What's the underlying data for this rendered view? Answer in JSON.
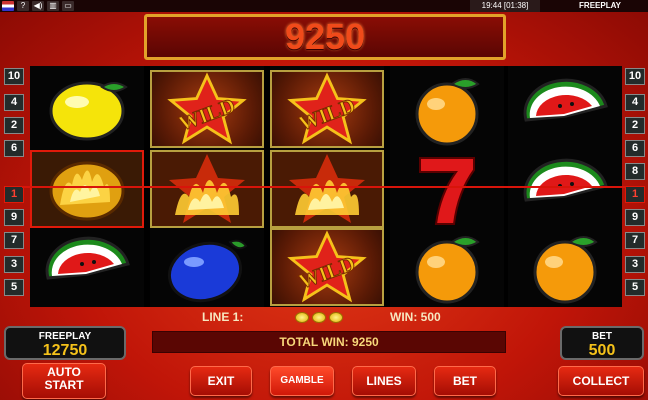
{
  "topbar": {
    "icons": [
      "flag-icon",
      "help-icon",
      "sound-icon",
      "settings-icon",
      "fullscreen-icon"
    ],
    "clock": "19:44 [01:38]",
    "mode": "FREEPLAY"
  },
  "win_display": "9250",
  "reels": [
    [
      "lemon",
      "lemon-burning",
      "watermelon"
    ],
    [
      "wild",
      "wild-burning",
      "plum"
    ],
    [
      "wild",
      "wild-burning",
      "wild"
    ],
    [
      "orange",
      "seven",
      "orange"
    ],
    [
      "watermelon",
      "watermelon",
      "orange"
    ]
  ],
  "lines_left": [
    "10",
    "4",
    "2",
    "6",
    "1",
    "9",
    "7",
    "3",
    "5"
  ],
  "lines_right": [
    "10",
    "4",
    "2",
    "6",
    "8",
    "1",
    "9",
    "7",
    "3",
    "5"
  ],
  "line_info": {
    "line_label": "LINE 1:",
    "win_label": "WIN: 500",
    "coins": 3
  },
  "total_win": "TOTAL WIN: 9250",
  "freeplay": {
    "label": "FREEPLAY",
    "value": "12750"
  },
  "bet": {
    "label": "BET",
    "value": "500"
  },
  "buttons": {
    "autostart_1": "AUTO",
    "autostart_2": "START",
    "exit": "EXIT",
    "gamble": "GAMBLE",
    "lines": "LINES",
    "bet": "BET",
    "collect": "COLLECT"
  }
}
